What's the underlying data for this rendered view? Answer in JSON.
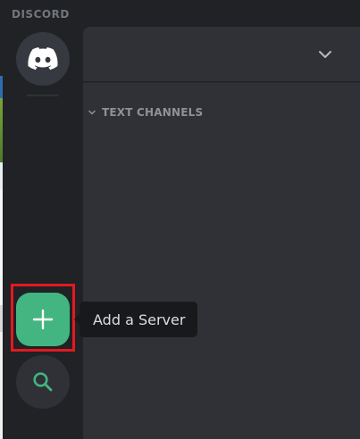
{
  "titlebar": {
    "brand": "DISCORD"
  },
  "rail": {
    "home": {
      "icon": "discord-logo-icon"
    },
    "add_server": {
      "icon": "plus-icon",
      "tooltip": "Add a Server"
    },
    "explore": {
      "icon": "search-icon"
    }
  },
  "channels": {
    "header_icon": "chevron-down-icon",
    "category": {
      "label": "TEXT CHANNELS",
      "icon": "chevron-down-icon"
    }
  },
  "colors": {
    "rail_bg": "#202225",
    "sidebar_bg": "#2f3136",
    "add_green": "#43b581",
    "highlight_red": "#e4191f",
    "tooltip_bg": "#18191c"
  }
}
